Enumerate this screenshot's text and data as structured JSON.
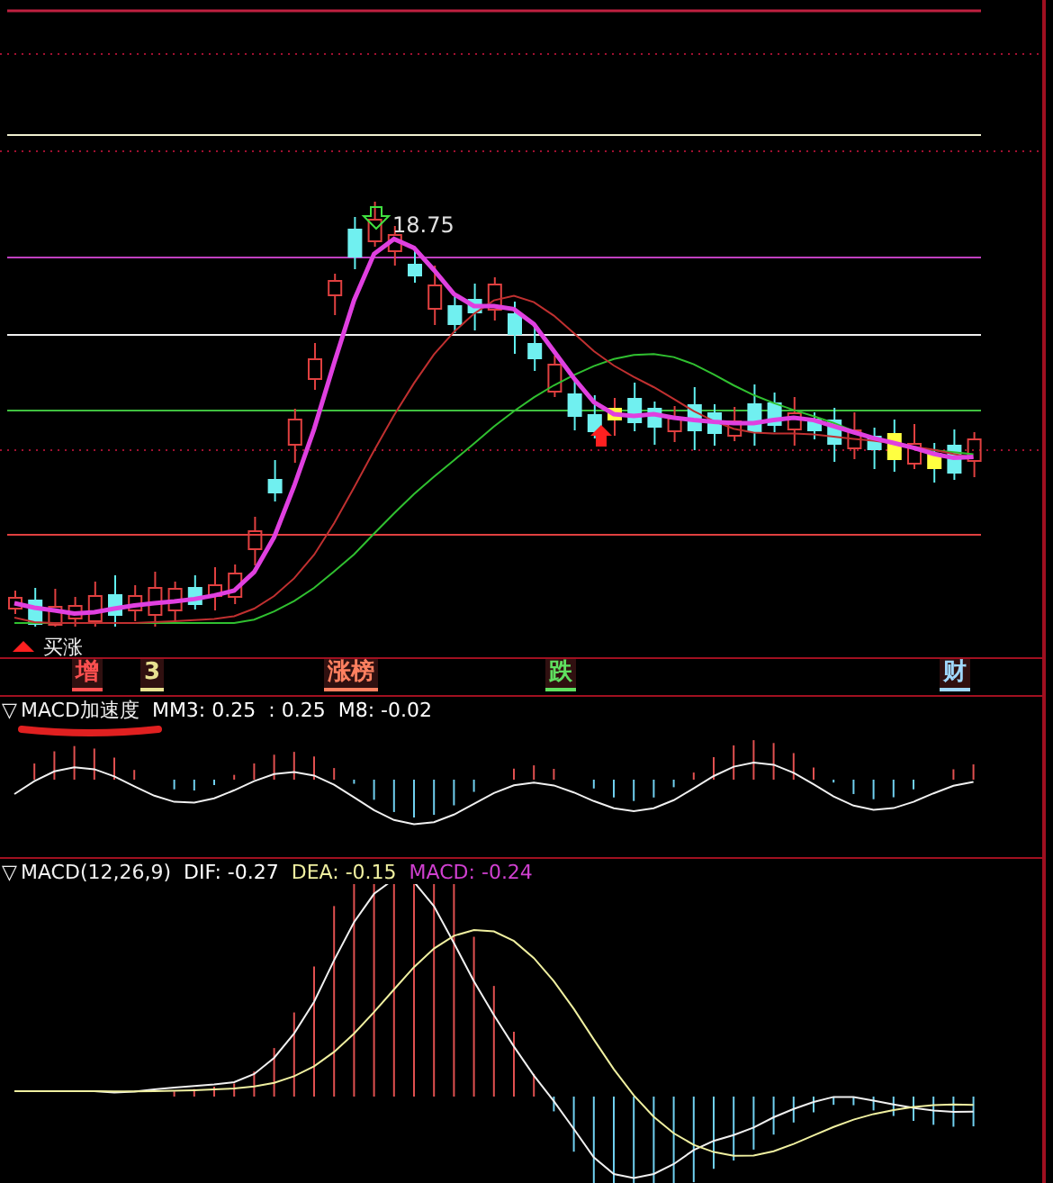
{
  "main_chart": {
    "price_label": "18.75",
    "signals": [
      {
        "text": "买涨"
      }
    ]
  },
  "event_strip": [
    {
      "text": "增",
      "color": "#ff5050"
    },
    {
      "text": "3",
      "color": "#e8e090"
    },
    {
      "text": "涨榜",
      "color": "#ff8060"
    },
    {
      "text": "跌",
      "color": "#60e060"
    },
    {
      "text": "财",
      "color": "#a0d8ff"
    }
  ],
  "indicators": [
    {
      "toggle": "▽",
      "name": "MACD加速度",
      "values": [
        {
          "text": "MM3: 0.25",
          "color": "#ffffff"
        },
        {
          "text": ": 0.25",
          "color": "#ffffff"
        },
        {
          "text": "M8: -0.02",
          "color": "#ffffff"
        }
      ]
    },
    {
      "toggle": "▽",
      "name": "MACD(12,26,9)",
      "values": [
        {
          "text": "DIF: -0.27",
          "color": "#ffffff"
        },
        {
          "text": "DEA: -0.15",
          "color": "#f0f0a0"
        },
        {
          "text": "MACD: -0.24",
          "color": "#d040d0"
        }
      ]
    }
  ]
}
